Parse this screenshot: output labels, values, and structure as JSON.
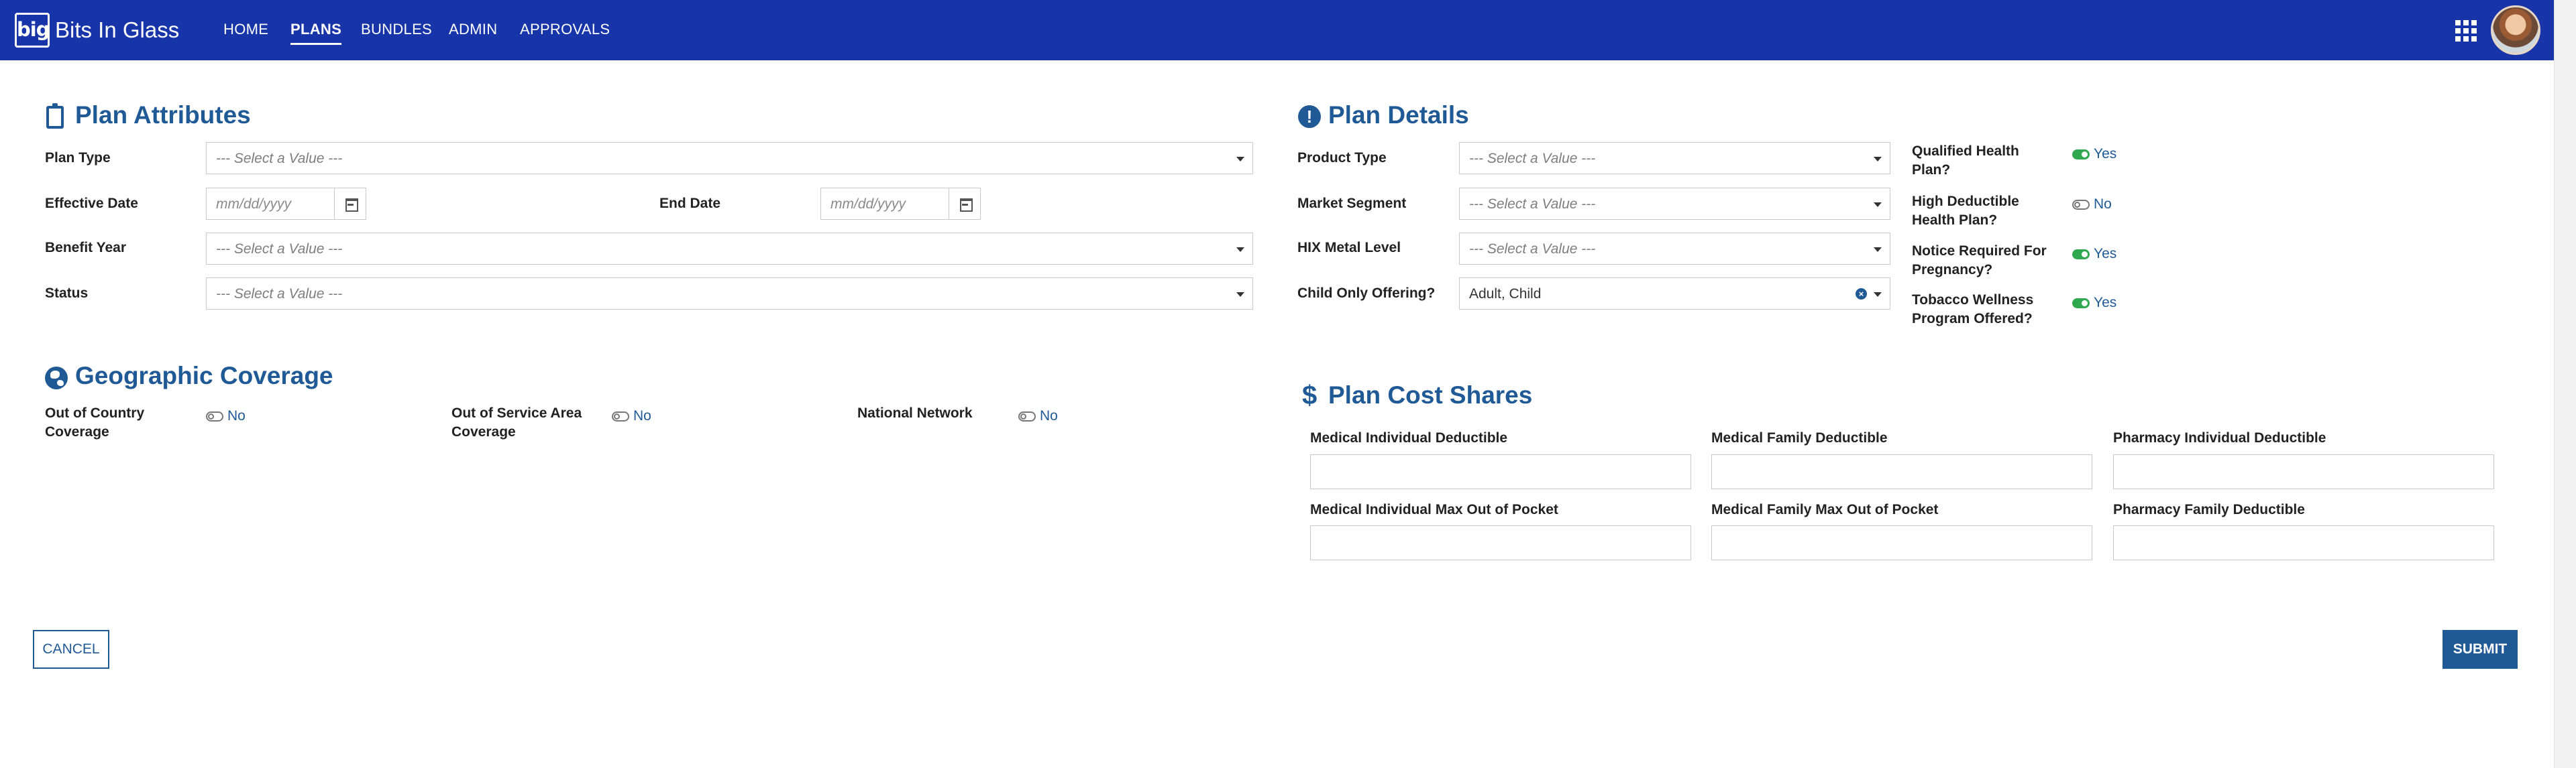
{
  "header": {
    "logo_text": "big",
    "brand": "Bits In Glass",
    "nav": [
      {
        "label": "HOME",
        "active": false
      },
      {
        "label": "PLANS",
        "active": true
      },
      {
        "label": "BUNDLES",
        "active": false
      },
      {
        "label": "ADMIN",
        "active": false
      },
      {
        "label": "APPROVALS",
        "active": false
      }
    ],
    "apps_icon": "grid-apps-icon",
    "avatar_icon": "user-avatar"
  },
  "plan_attributes": {
    "title": "Plan Attributes",
    "icon": "clipboard-icon",
    "plan_type": {
      "label": "Plan Type",
      "value": "--- Select a Value ---"
    },
    "effective_date": {
      "label": "Effective Date",
      "placeholder": "mm/dd/yyyy"
    },
    "end_date": {
      "label": "End Date",
      "placeholder": "mm/dd/yyyy"
    },
    "benefit_year": {
      "label": "Benefit Year",
      "value": "--- Select a Value ---"
    },
    "status": {
      "label": "Status",
      "value": "--- Select a Value ---"
    }
  },
  "geographic_coverage": {
    "title": "Geographic Coverage",
    "icon": "globe-icon",
    "out_of_country": {
      "label_line1": "Out of Country",
      "label_line2": "Coverage",
      "value": "No",
      "on": false
    },
    "out_of_service_area": {
      "label_line1": "Out of Service Area",
      "label_line2": "Coverage",
      "value": "No",
      "on": false
    },
    "national_network": {
      "label": "National Network",
      "value": "No",
      "on": false
    }
  },
  "plan_details": {
    "title": "Plan Details",
    "icon": "exclamation-circle-icon",
    "product_type": {
      "label": "Product Type",
      "value": "--- Select a Value ---"
    },
    "market_segment": {
      "label": "Market Segment",
      "value": "--- Select a Value ---"
    },
    "hix_metal_level": {
      "label": "HIX Metal Level",
      "value": "--- Select a Value ---"
    },
    "child_only_offering": {
      "label": "Child Only Offering?",
      "value": "Adult, Child"
    },
    "qualified_health_plan": {
      "label_line1": "Qualified Health",
      "label_line2": "Plan?",
      "value": "Yes",
      "on": true
    },
    "high_deductible": {
      "label_line1": "High Deductible",
      "label_line2": "Health Plan?",
      "value": "No",
      "on": false
    },
    "notice_pregnancy": {
      "label_line1": "Notice Required For",
      "label_line2": "Pregnancy?",
      "value": "Yes",
      "on": true
    },
    "tobacco_wellness": {
      "label_line1": "Tobacco Wellness",
      "label_line2": "Program Offered?",
      "value": "Yes",
      "on": true
    }
  },
  "plan_cost_shares": {
    "title": "Plan Cost Shares",
    "icon": "dollar-icon",
    "fields": [
      {
        "label": "Medical Individual Deductible",
        "value": ""
      },
      {
        "label": "Medical Family Deductible",
        "value": ""
      },
      {
        "label": "Pharmacy Individual Deductible",
        "value": ""
      },
      {
        "label": "Medical Individual Max Out of Pocket",
        "value": ""
      },
      {
        "label": "Medical Family Max Out of Pocket",
        "value": ""
      },
      {
        "label": "Pharmacy Family Deductible",
        "value": ""
      }
    ]
  },
  "actions": {
    "cancel": "CANCEL",
    "submit": "SUBMIT"
  },
  "colors": {
    "header_bg": "#1734a8",
    "accent": "#1f5a96",
    "toggle_on": "#2fa84f"
  }
}
